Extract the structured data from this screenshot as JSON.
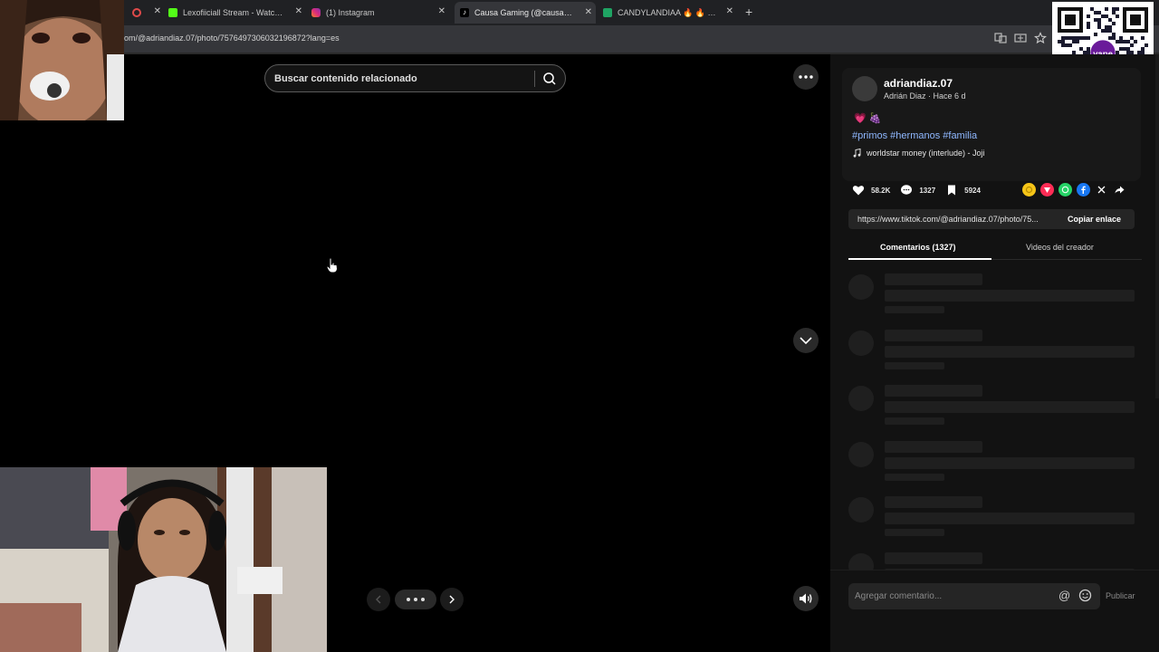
{
  "browser": {
    "tabs": [
      {
        "label": "",
        "active": false,
        "fav_color": "#e04a4a"
      },
      {
        "label": "Lexofiiciall Stream - Watch Live",
        "active": false,
        "fav_color": "#53fc18"
      },
      {
        "label": "(1) Instagram",
        "active": false,
        "fav_color": "#d62976"
      },
      {
        "label": "Causa Gaming (@causagaming",
        "active": true,
        "fav_color": "#ffffff"
      },
      {
        "label": "CANDYLANDIAA 🔥 🔥 🔥 🔥",
        "active": false,
        "fav_color": "#1fa463"
      }
    ],
    "url": "om/@adriandiaz.07/photo/7576497306032196872?lang=es"
  },
  "stage": {
    "search_placeholder": "Buscar contenido relacionado"
  },
  "post": {
    "username": "adriandiaz.07",
    "subline": "Adrián Diaz · Hace 6 d",
    "emojis": "💗 🍇",
    "hashtags": "#primos #hermanos #familia",
    "music": "worldstar money (interlude) - Joji",
    "likes": "58.2K",
    "comments": "1327",
    "saves": "5924",
    "link": "https://www.tiktok.com/@adriandiaz.07/photo/75...",
    "copy_label": "Copiar enlace",
    "tab_comments": "Comentarios (1327)",
    "tab_videos": "Videos del creador",
    "comment_placeholder": "Agregar comentario...",
    "publish_label": "Publicar",
    "at_symbol": "@",
    "share_colors": {
      "coin": "#f5c518",
      "repost": "#fe2c55",
      "whatsapp": "#25d366",
      "facebook": "#1877f2",
      "x": "#121212"
    }
  },
  "qr": {
    "logo_text": "yape"
  }
}
